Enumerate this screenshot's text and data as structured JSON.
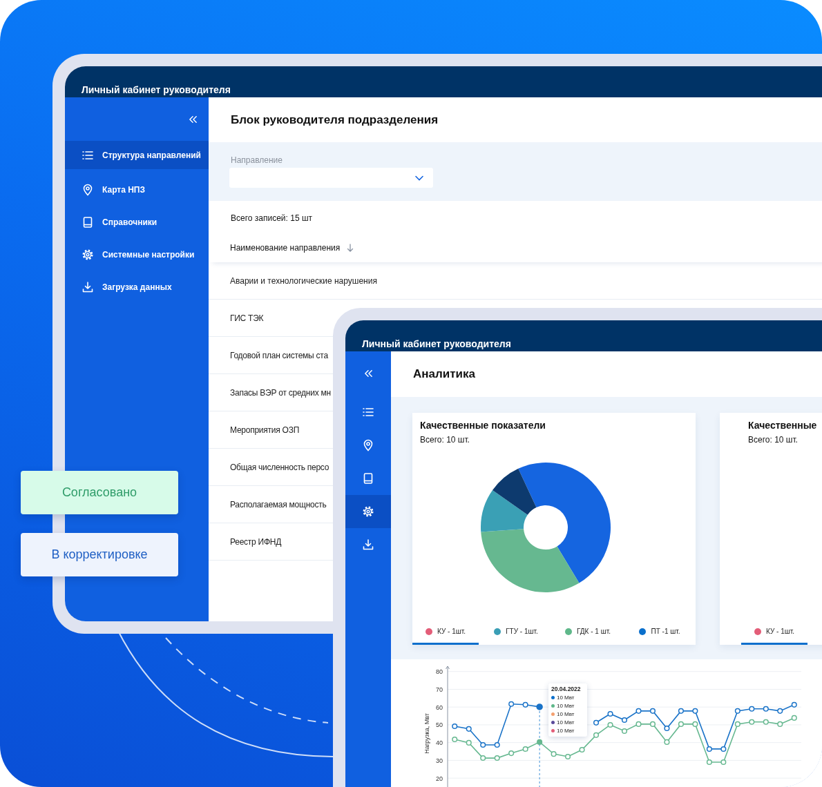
{
  "badges": [
    {
      "label": "Согласовано",
      "kind": "approved"
    },
    {
      "label": "В корректировке",
      "kind": "correction"
    }
  ],
  "main_window": {
    "title": "Личный кабинет руководителя",
    "sidebar": {
      "items": [
        {
          "label": "Структура направлений",
          "selected": true
        },
        {
          "label": "Карта НПЗ",
          "selected": false
        },
        {
          "label": "Справочники",
          "selected": false
        },
        {
          "label": "Системные настройки",
          "selected": false
        },
        {
          "label": "Загрузка данных",
          "selected": false
        }
      ]
    },
    "page_title": "Блок руководителя подразделения",
    "filter": {
      "label": "Направление"
    },
    "records_total": "Всего записей: 15 шт",
    "table": {
      "columns": [
        "Наименование направления"
      ],
      "rows": [
        "Аварии и технологические нарушения",
        "ГИС ТЭК",
        "Годовой план системы ста",
        "Запасы ВЭР от средних мн",
        "Мероприятия ОЗП",
        "Общая численность персо",
        "Располагаемая мощность",
        "Реестр ИФНД"
      ]
    }
  },
  "analytics_window": {
    "title": "Личный кабинет руководителя",
    "sidebar": {
      "items": [
        {
          "selected": false
        },
        {
          "selected": false
        },
        {
          "selected": false
        },
        {
          "selected": true
        },
        {
          "selected": false
        }
      ]
    },
    "page_title": "Аналитика",
    "cards": [
      {
        "title": "Качественные показатели",
        "total": "Всего: 10 шт.",
        "legend": [
          {
            "label": "КУ - 1шт.",
            "color": "#e35d78",
            "selected": true
          },
          {
            "label": "ГТУ - 1шт.",
            "color": "#3a9eb5",
            "selected": false
          },
          {
            "label": "ГДК - 1 шт.",
            "color": "#5fb88a",
            "selected": false
          },
          {
            "label": "ПТ -1 шт.",
            "color": "#0a6fcc",
            "selected": false
          }
        ]
      },
      {
        "title": "Качественные",
        "total": "Всего: 10 шт.",
        "legend": [
          {
            "label": "КУ - 1шт.",
            "color": "#e35d78",
            "selected": true
          }
        ]
      }
    ],
    "line_chart": {
      "chart_data": {
        "type": "line",
        "ylabel": "Нагрузка, Мвт",
        "ylim": [
          15,
          83
        ],
        "grid": true,
        "yticks": [
          20,
          30,
          40,
          50,
          60,
          70,
          80
        ],
        "categories": [
          null,
          null,
          null,
          null,
          null,
          null,
          null,
          null,
          null,
          null,
          null,
          null,
          null,
          null,
          null,
          null,
          null,
          null,
          null,
          null,
          null,
          null,
          null,
          null,
          null
        ],
        "series": [
          {
            "color": "#1a73c8",
            "marker": "circle",
            "values": [
              49.2,
              47.7,
              38.7,
              38.7,
              61.7,
              61.3,
              60.1,
              null,
              null,
              null,
              51.2,
              56.2,
              52.7,
              57.8,
              57.8,
              48,
              57.8,
              57.8,
              36.4,
              36.4,
              57.8,
              59,
              59,
              57.8,
              61.3
            ]
          },
          {
            "color": "#66b890",
            "marker": "circle",
            "values": [
              41.8,
              39.9,
              31.3,
              31.3,
              34,
              36.4,
              40.3,
              33.6,
              32.1,
              36,
              44.2,
              50,
              46.5,
              50.4,
              50.4,
              40.3,
              50.4,
              50.4,
              29,
              29,
              50.4,
              51.6,
              51.6,
              50.4,
              53.9
            ]
          }
        ]
      },
      "tooltip": {
        "title": "20.04.2022",
        "items": [
          {
            "label": "10 Мвт",
            "color": "#0a6fcc"
          },
          {
            "label": "10 Мвт",
            "color": "#5fb88a"
          },
          {
            "label": "10 Мвт",
            "color": "#f4a070"
          },
          {
            "label": "10 Мвт",
            "color": "#5a4a9a"
          },
          {
            "label": "10 Мвт",
            "color": "#e35d78"
          }
        ]
      }
    }
  }
}
